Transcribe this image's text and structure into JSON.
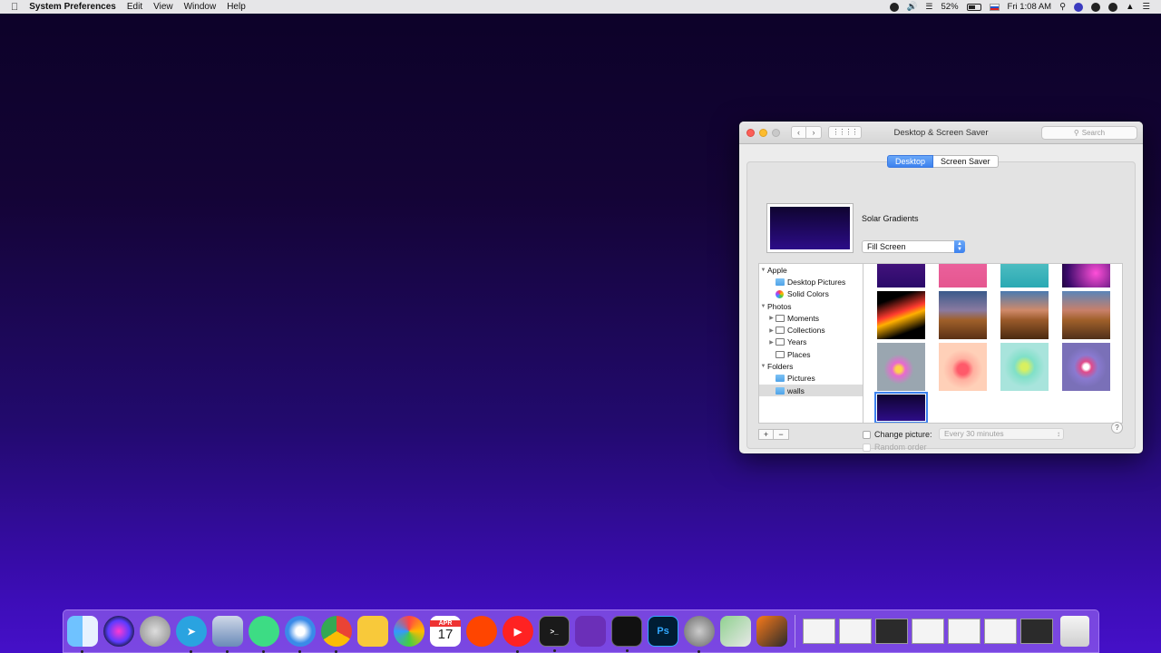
{
  "menubar": {
    "app_name": "System Preferences",
    "menus": [
      "Edit",
      "View",
      "Window",
      "Help"
    ],
    "battery": "52%",
    "clock": "Fri 1:08 AM"
  },
  "window": {
    "title": "Desktop & Screen Saver",
    "search_placeholder": "Search",
    "tabs": {
      "desktop": "Desktop",
      "screensaver": "Screen Saver"
    },
    "wallpaper_name": "Solar Gradients",
    "fill_mode": "Fill Screen",
    "sidebar": [
      {
        "label": "Apple",
        "level": 0,
        "icon": "disclosure-open"
      },
      {
        "label": "Desktop Pictures",
        "level": 1,
        "icon": "folder-blue"
      },
      {
        "label": "Solid Colors",
        "level": 1,
        "icon": "color-wheel"
      },
      {
        "label": "Photos",
        "level": 0,
        "icon": "disclosure-open"
      },
      {
        "label": "Moments",
        "level": 1,
        "icon": "photo-folder"
      },
      {
        "label": "Collections",
        "level": 1,
        "icon": "photo-folder"
      },
      {
        "label": "Years",
        "level": 1,
        "icon": "photo-folder"
      },
      {
        "label": "Places",
        "level": 1,
        "icon": "photo-folder"
      },
      {
        "label": "Folders",
        "level": 0,
        "icon": "disclosure-open"
      },
      {
        "label": "Pictures",
        "level": 1,
        "icon": "folder-blue"
      },
      {
        "label": "walls",
        "level": 1,
        "icon": "folder-blue",
        "selected": true
      }
    ],
    "change_picture_label": "Change picture:",
    "interval": "Every 30 minutes",
    "random_order_label": "Random order",
    "help": "?"
  },
  "dock": {
    "apps": [
      "Finder",
      "Siri",
      "Launchpad",
      "Telegram",
      "Preview",
      "Android Studio",
      "Safari",
      "Chrome",
      "Lightbulb",
      "Photos",
      "Calendar",
      "Reddit",
      "YouTube Music",
      "Terminal",
      "Visual Studio",
      "Activity Monitor",
      "Photoshop",
      "System Preferences",
      "Maps",
      "Artstudio"
    ],
    "calendar_month": "APR",
    "calendar_day": "17",
    "photoshop_label": "Ps"
  }
}
